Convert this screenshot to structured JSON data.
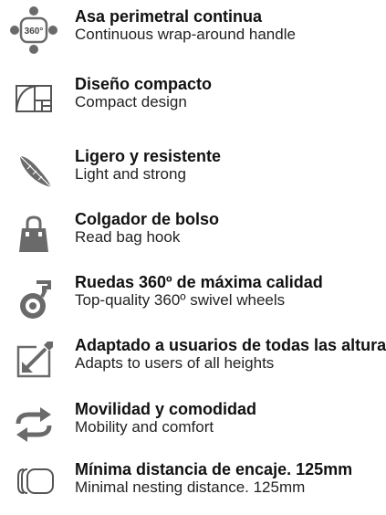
{
  "features": [
    {
      "icon": "360-handle-icon",
      "title": "Asa perimetral continua",
      "subtitle": "Continuous wrap-around handle",
      "icon_text": "360°"
    },
    {
      "icon": "compact-design-icon",
      "title": "Diseño compacto",
      "subtitle": "Compact design"
    },
    {
      "icon": "feather-icon",
      "title": "Ligero y resistente",
      "subtitle": "Light and strong"
    },
    {
      "icon": "bag-hook-icon",
      "title": "Colgador de bolso",
      "subtitle": "Read bag hook"
    },
    {
      "icon": "swivel-wheel-icon",
      "title": "Ruedas 360º de máxima calidad",
      "subtitle": "Top-quality 360º swivel wheels"
    },
    {
      "icon": "resize-arrow-icon",
      "title": "Adaptado a usuarios de todas las alturas",
      "subtitle": "Adapts to users of all heights"
    },
    {
      "icon": "swap-arrows-icon",
      "title": "Movilidad y comodidad",
      "subtitle": "Mobility and comfort"
    },
    {
      "icon": "nesting-icon",
      "title": "Mínima distancia de encaje. 125mm",
      "subtitle": "Minimal nesting distance. 125mm"
    }
  ],
  "colors": {
    "icon": "#6a6a6a",
    "text": "#111111"
  }
}
